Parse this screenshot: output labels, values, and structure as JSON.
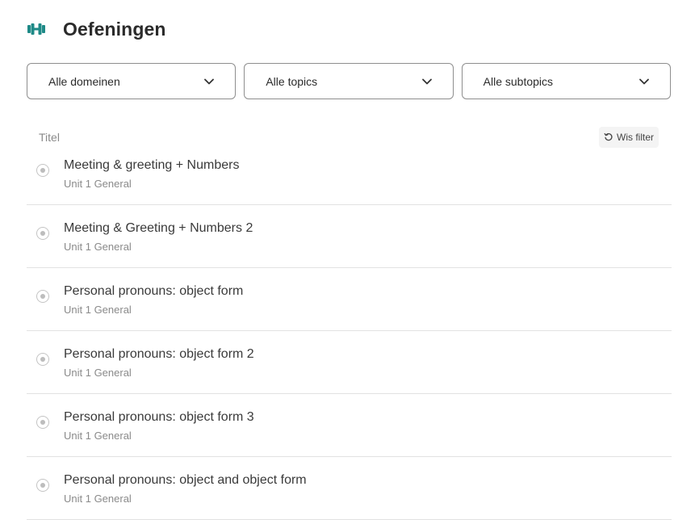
{
  "header": {
    "title": "Oefeningen",
    "icon": "dumbbell-icon",
    "accent_color": "#1f8a87"
  },
  "filters": {
    "domain": {
      "value": "Alle domeinen"
    },
    "topic": {
      "value": "Alle topics"
    },
    "subtopic": {
      "value": "Alle subtopics"
    }
  },
  "list": {
    "column_title": "Titel",
    "clear_filter_label": "Wis filter",
    "items": [
      {
        "title": "Meeting & greeting + Numbers",
        "subtitle": "Unit 1 General"
      },
      {
        "title": "Meeting & Greeting + Numbers 2",
        "subtitle": "Unit 1 General"
      },
      {
        "title": "Personal pronouns: object form",
        "subtitle": "Unit 1 General"
      },
      {
        "title": "Personal pronouns: object form 2",
        "subtitle": "Unit 1 General"
      },
      {
        "title": "Personal pronouns: object form 3",
        "subtitle": "Unit 1 General"
      },
      {
        "title": "Personal pronouns: object and object form",
        "subtitle": "Unit 1 General"
      }
    ]
  }
}
